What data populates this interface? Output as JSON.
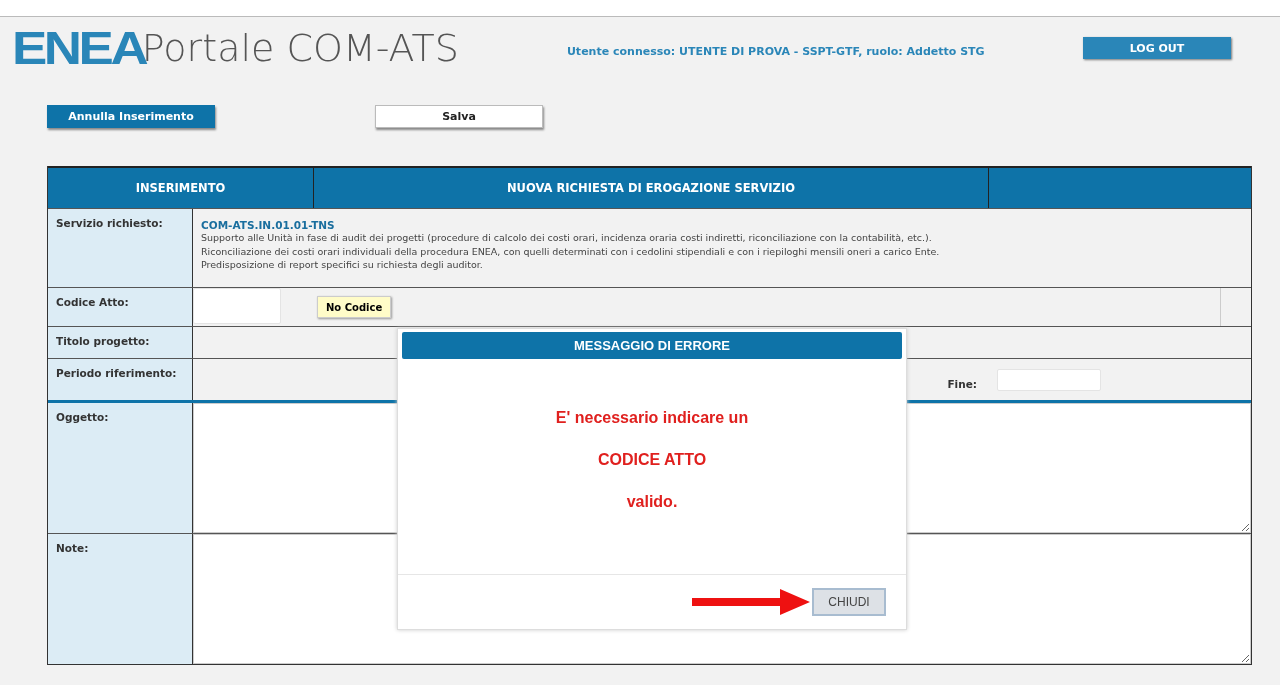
{
  "header": {
    "logo": "ENEA",
    "title": "Portale COM-ATS",
    "user_info": "Utente connesso: UTENTE DI PROVA - SSPT-GTF, ruolo: Addetto STG",
    "logout": "LOG OUT"
  },
  "actions": [
    {
      "label": "Annulla Inserimento",
      "kind": "primary"
    },
    {
      "label": "Salva",
      "kind": "secondary"
    }
  ],
  "table": {
    "columns": [
      "INSERIMENTO",
      "NUOVA RICHIESTA DI EROGAZIONE SERVIZIO"
    ],
    "rows": [
      {
        "kind": "service",
        "label": "Servizio richiesto:",
        "code": "COM-ATS.IN.01.01-TNS",
        "lines": [
          "Supporto alle Unità in fase di audit dei progetti (procedure di calcolo dei costi orari, incidenza oraria costi indiretti, riconciliazione con la contabilità, etc.).",
          "Riconciliazione dei costi orari individuali della procedura ENEA, con quelli determinati con i cedolini stipendiali e con i riepiloghi mensili oneri a carico Ente.",
          "Predisposizione di report specifici su richiesta degli auditor."
        ]
      },
      {
        "kind": "code",
        "label": "Codice Atto:",
        "button": "No Codice"
      },
      {
        "kind": "plain",
        "label": "Titolo progetto:"
      },
      {
        "kind": "period",
        "label": "Periodo riferimento:",
        "end_label": "Fine:"
      },
      {
        "kind": "textarea",
        "label": "Oggetto:"
      },
      {
        "kind": "textarea",
        "label": "Note:"
      }
    ]
  },
  "modal": {
    "title": "MESSAGGIO DI ERRORE",
    "lines": [
      "E' necessario indicare un",
      "CODICE ATTO",
      "valido."
    ],
    "close_button": "CHIUDI"
  }
}
